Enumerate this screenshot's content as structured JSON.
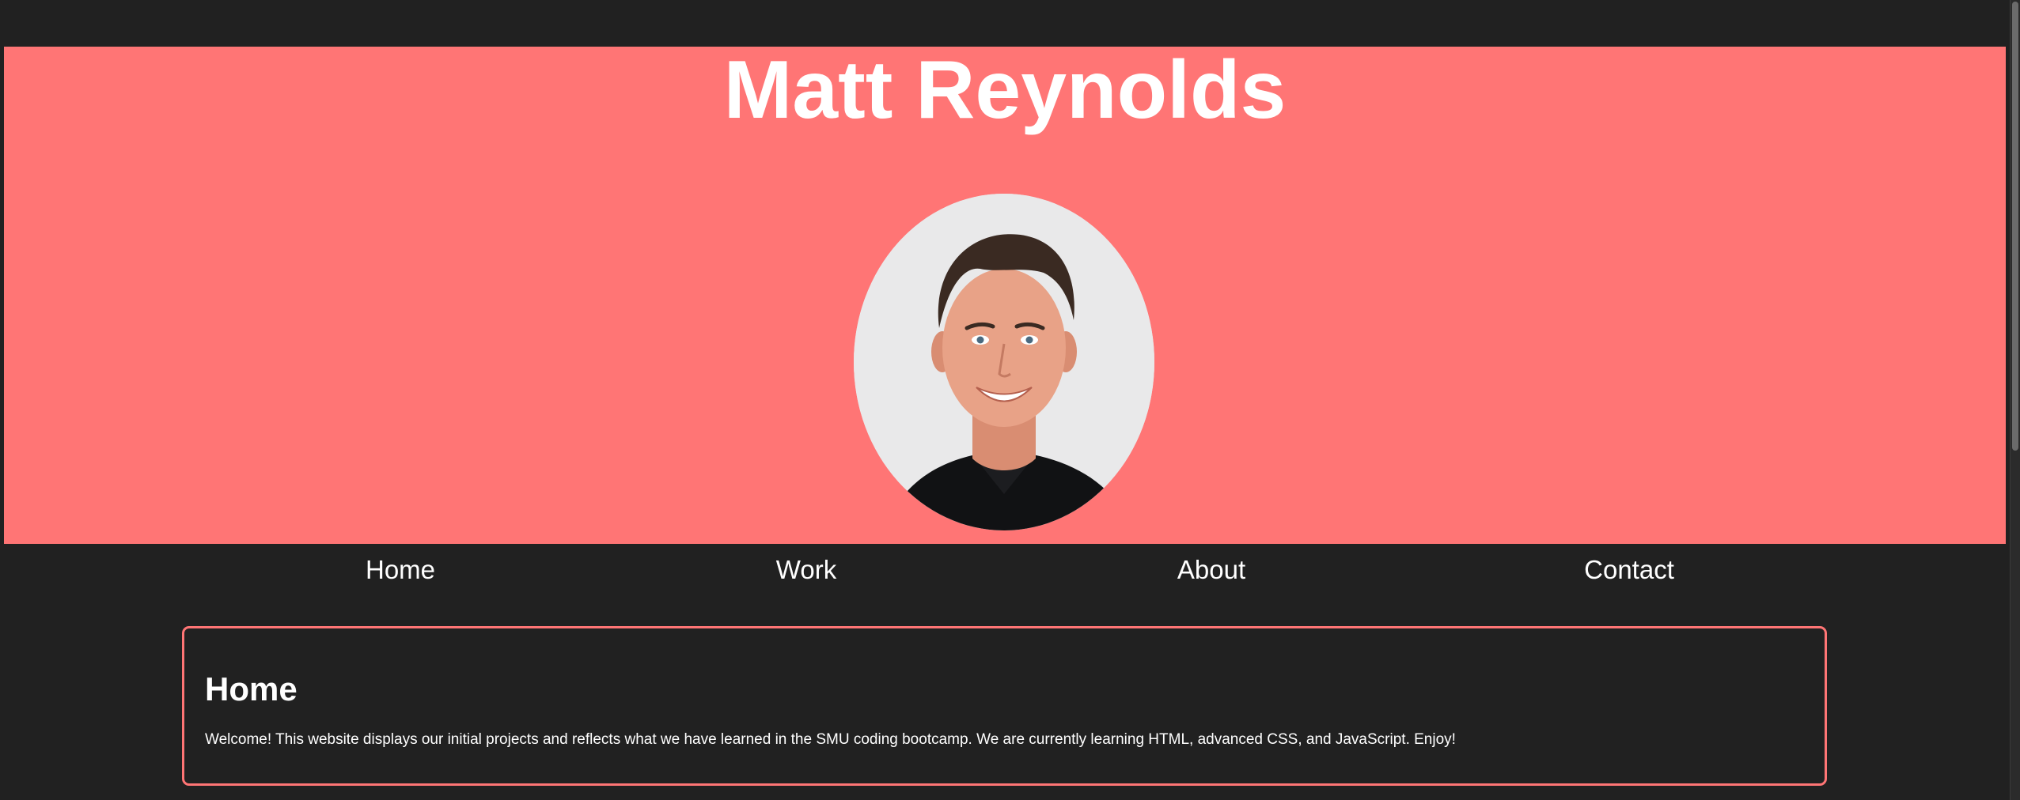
{
  "header": {
    "title": "Matt Reynolds",
    "background_color": "#ff7575",
    "avatar": {
      "alt": "Matt Reynolds portrait",
      "icon": "profile-photo"
    }
  },
  "nav": {
    "items": [
      {
        "label": "Home"
      },
      {
        "label": "Work"
      },
      {
        "label": "About"
      },
      {
        "label": "Contact"
      }
    ]
  },
  "main": {
    "section_title": "Home",
    "section_text": "Welcome! This website displays our initial projects and reflects what we have learned in the SMU coding bootcamp. We are currently learning HTML, advanced CSS, and JavaScript. Enjoy!",
    "border_color": "#ff7575"
  },
  "page": {
    "background_color": "#212121"
  }
}
